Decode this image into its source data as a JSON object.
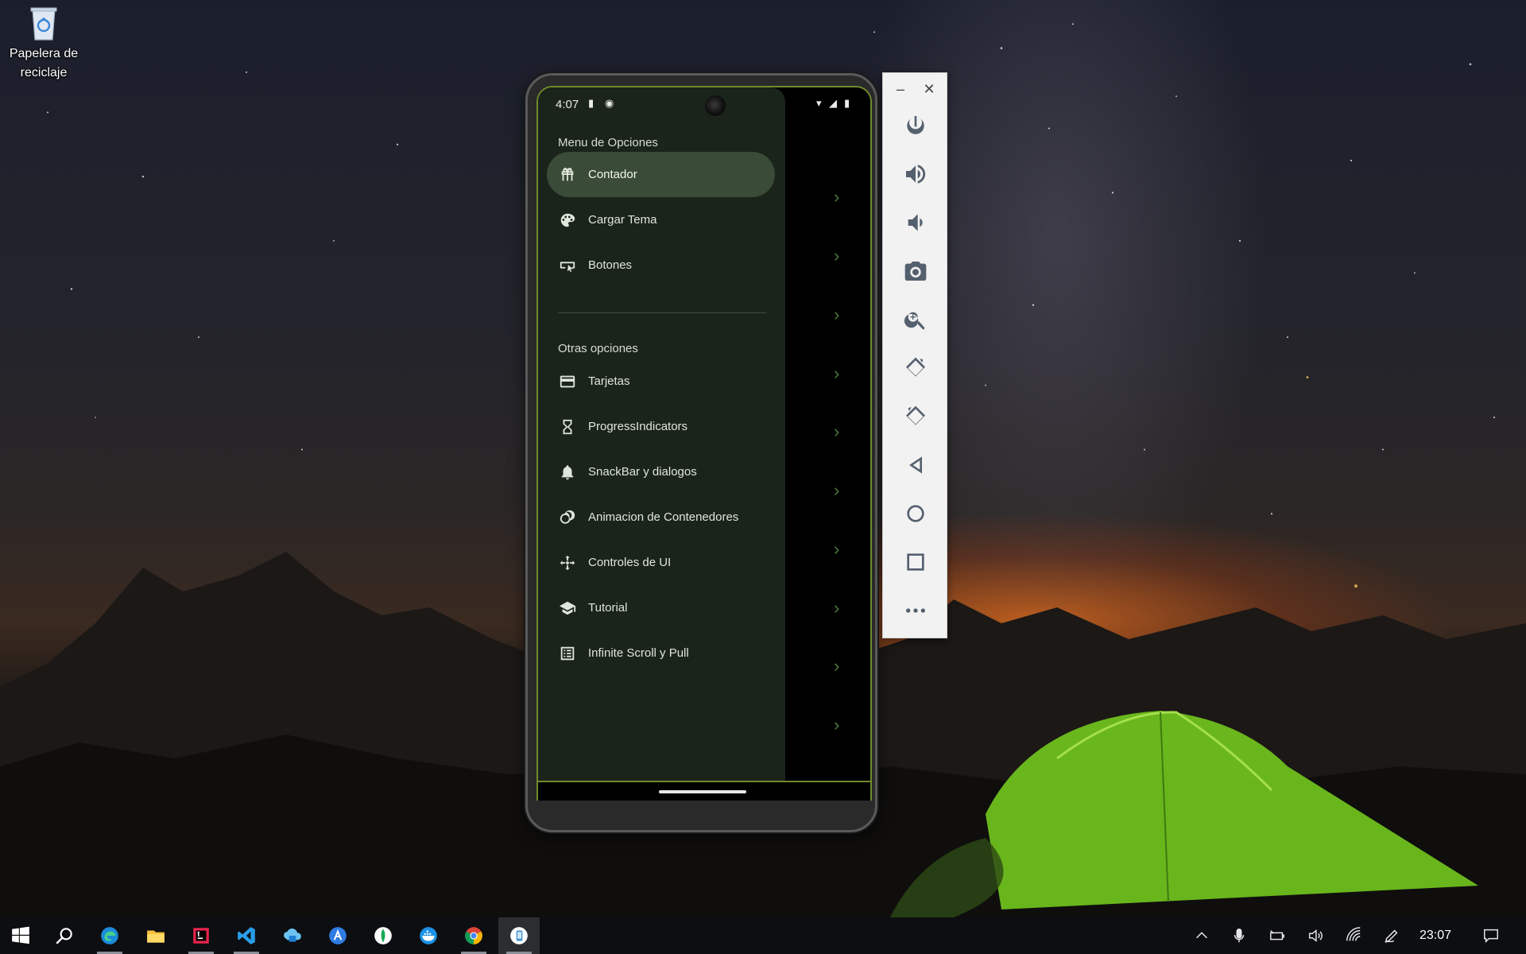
{
  "desktop": {
    "recycle_bin_label": "Papelera de reciclaje"
  },
  "phone": {
    "status": {
      "time": "4:07"
    },
    "drawer": {
      "header": "Menu de Opciones",
      "items": [
        {
          "label": "Contador",
          "icon": "gift-icon",
          "active": true
        },
        {
          "label": "Cargar Tema",
          "icon": "palette-icon",
          "active": false
        },
        {
          "label": "Botones",
          "icon": "button-icon",
          "active": false
        }
      ],
      "other_header": "Otras opciones",
      "other_items": [
        {
          "label": "Tarjetas",
          "icon": "credit-card-icon"
        },
        {
          "label": "ProgressIndicators",
          "icon": "hourglass-icon"
        },
        {
          "label": "SnackBar y dialogos",
          "icon": "bell-icon"
        },
        {
          "label": "Animacion de Contenedores",
          "icon": "animation-icon"
        },
        {
          "label": "Controles de UI",
          "icon": "move-arrows-icon"
        },
        {
          "label": "Tutorial",
          "icon": "school-icon"
        },
        {
          "label": "Infinite Scroll y Pull",
          "icon": "list-icon"
        }
      ]
    },
    "colors": {
      "drawer_bg": "#1b241b",
      "active_item_bg": "#3a4b38",
      "chevron": "#4d7a3a",
      "frame_accent": "#708a2c"
    }
  },
  "emulator_toolbar": {
    "minimize": "–",
    "close": "✕",
    "buttons": [
      "power-icon",
      "volume-up-icon",
      "volume-down-icon",
      "camera-icon",
      "zoom-in-icon",
      "rotate-left-icon",
      "rotate-right-icon",
      "back-icon",
      "home-icon",
      "overview-icon",
      "more-icon"
    ]
  },
  "taskbar": {
    "apps": [
      "windows-start-icon",
      "search-icon",
      "edge-icon",
      "file-explorer-icon",
      "jetbrains-icon",
      "vscode-icon",
      "azure-data-studio-icon",
      "app-icon",
      "mongodb-compass-icon",
      "docker-icon",
      "chrome-icon",
      "android-emulator-icon"
    ],
    "tray": [
      "chevron-up-icon",
      "microphone-icon",
      "battery-icon",
      "volume-icon",
      "wifi-icon",
      "pen-icon"
    ],
    "clock": "23:07",
    "notification_icon": "notification-icon"
  }
}
